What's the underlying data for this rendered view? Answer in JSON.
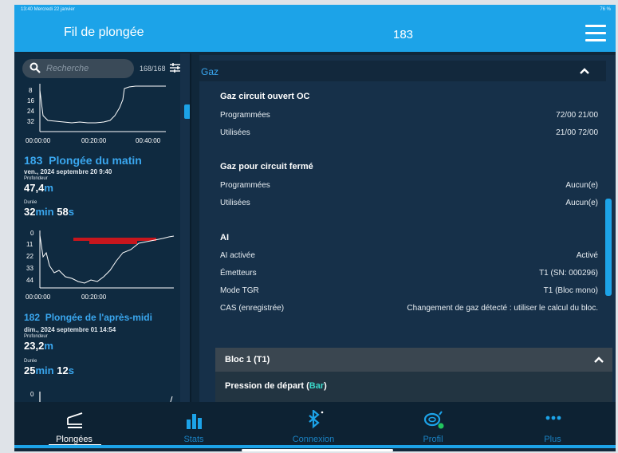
{
  "status_bar": {
    "left": "13:40  Mercredi 22 janvier",
    "right": "76 %"
  },
  "app_bar": {
    "title": "Fil de plongée",
    "dive_number": "183"
  },
  "search": {
    "placeholder": "Recherche",
    "count": "168/168"
  },
  "dive_list": [
    {
      "partial": true,
      "chart": {
        "y_ticks": [
          "8",
          "16",
          "24",
          "32"
        ],
        "x_ticks": [
          "00:00:00",
          "00:20:00",
          "00:40:00"
        ]
      }
    },
    {
      "number": "183",
      "name": "Plongée du matin",
      "date": "ven., 2024 septembre 20 9:40",
      "depth_label": "Profondeur",
      "depth_value": "47,4",
      "depth_unit": "m",
      "duration_label": "Durée",
      "duration_min": "32",
      "duration_min_unit": "min",
      "duration_sec": "58",
      "duration_sec_unit": "s",
      "chart": {
        "y_ticks": [
          "0",
          "11",
          "22",
          "33",
          "44"
        ],
        "x_ticks": [
          "00:00:00",
          "00:20:00"
        ]
      }
    },
    {
      "number": "182",
      "name": "Plongée de l'après-midi",
      "date": "dim., 2024 septembre 01 14:54",
      "depth_label": "Profondeur",
      "depth_value": "23,2",
      "depth_unit": "m",
      "duration_label": "Durée",
      "duration_min": "25",
      "duration_min_unit": "min",
      "duration_sec": "12",
      "duration_sec_unit": "s",
      "chart": {
        "y_ticks": [
          "0"
        ]
      }
    }
  ],
  "details": {
    "section_title": "Gaz",
    "oc": {
      "title": "Gaz circuit ouvert OC",
      "rows": [
        {
          "label": "Programmées",
          "value": "72/00 21/00"
        },
        {
          "label": "Utilisées",
          "value": "21/00 72/00"
        }
      ]
    },
    "ccr": {
      "title": "Gaz pour circuit fermé",
      "rows": [
        {
          "label": "Programmées",
          "value": "Aucun(e)"
        },
        {
          "label": "Utilisées",
          "value": "Aucun(e)"
        }
      ]
    },
    "ai": {
      "title": "AI",
      "rows": [
        {
          "label": "AI activée",
          "value": "Activé"
        },
        {
          "label": "Émetteurs",
          "value": "T1 (SN: 000296)"
        },
        {
          "label": "Mode TGR",
          "value": "T1 (Bloc mono)"
        },
        {
          "label": "CAS (enregistrée)",
          "value": "Changement de gaz détecté : utiliser le calcul du bloc."
        }
      ]
    },
    "bloc": {
      "title": "Bloc 1 (T1)",
      "pressure_label": "Pression de départ (",
      "pressure_unit": "Bar",
      "pressure_close": ")"
    }
  },
  "tabs": [
    {
      "label": "Plongées",
      "icon": "dive-log-icon",
      "active": true
    },
    {
      "label": "Stats",
      "icon": "bar-chart-icon",
      "active": false
    },
    {
      "label": "Connexion",
      "icon": "bluetooth-icon",
      "active": false
    },
    {
      "label": "Profil",
      "icon": "mask-icon",
      "active": false
    },
    {
      "label": "Plus",
      "icon": "more-icon",
      "active": false
    }
  ],
  "colors": {
    "accent": "#1ca3e8",
    "background": "#10273a",
    "unit_blue": "#3aa7ef",
    "gas_unit": "#3bd7c9",
    "chart_red": "#c8161d",
    "status_green": "#22c55e"
  }
}
